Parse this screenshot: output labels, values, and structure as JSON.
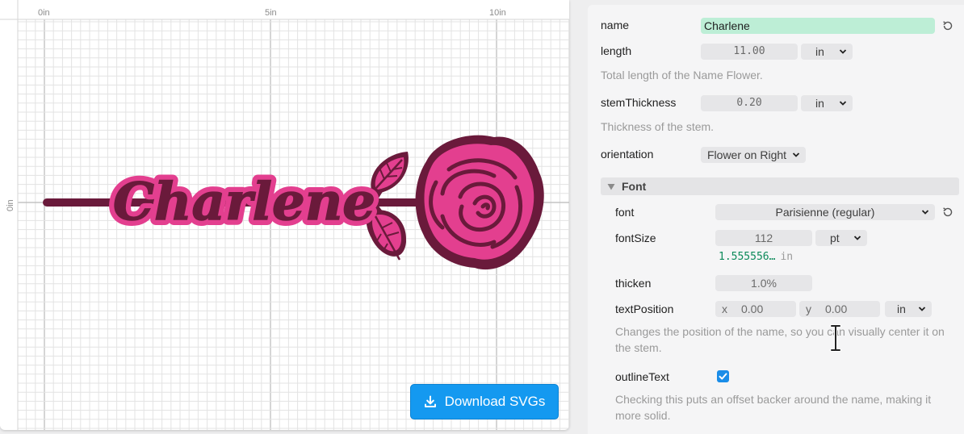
{
  "ruler": {
    "top_labels": [
      "0in",
      "5in",
      "10in"
    ],
    "left_labels": [
      "0in"
    ]
  },
  "design": {
    "name_text": "Charlene",
    "accent_pink": "#e33f8f",
    "outline_color": "#6a1a3b"
  },
  "download_button": {
    "label": "Download SVGs",
    "icon": "download-icon"
  },
  "params": {
    "name": {
      "label": "name",
      "value": "Charlene"
    },
    "length": {
      "label": "length",
      "value": "11.00",
      "unit": "in",
      "help": "Total length of the Name Flower."
    },
    "stemThickness": {
      "label": "stemThickness",
      "value": "0.20",
      "unit": "in",
      "help": "Thickness of the stem."
    },
    "orientation": {
      "label": "orientation",
      "value": "Flower on Right"
    }
  },
  "font_section": {
    "title": "Font",
    "font": {
      "label": "font",
      "value": "Parisienne (regular)"
    },
    "fontSize": {
      "label": "fontSize",
      "value": "112",
      "unit": "pt",
      "converted_value": "1.555556…",
      "converted_unit": "in"
    },
    "thicken": {
      "label": "thicken",
      "value": "1.0%"
    },
    "textPosition": {
      "label": "textPosition",
      "x_prefix": "x",
      "x_value": "0.00",
      "y_prefix": "y",
      "y_value": "0.00",
      "unit": "in",
      "help": "Changes the position of the name, so you can visually center it on the stem."
    },
    "outlineText": {
      "label": "outlineText",
      "checked": true,
      "help": "Checking this puts an offset backer around the name, making it more solid."
    }
  }
}
